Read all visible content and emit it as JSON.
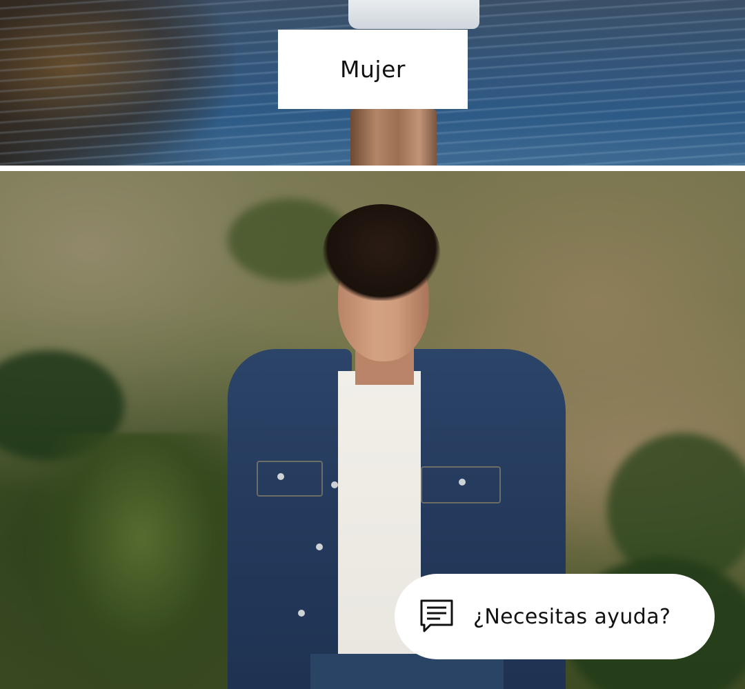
{
  "categories": [
    {
      "label": "Mujer"
    }
  ],
  "help": {
    "label": "¿Necesitas ayuda?",
    "icon": "chat-message-icon"
  },
  "colors": {
    "background": "#ffffff",
    "text": "#111111"
  }
}
